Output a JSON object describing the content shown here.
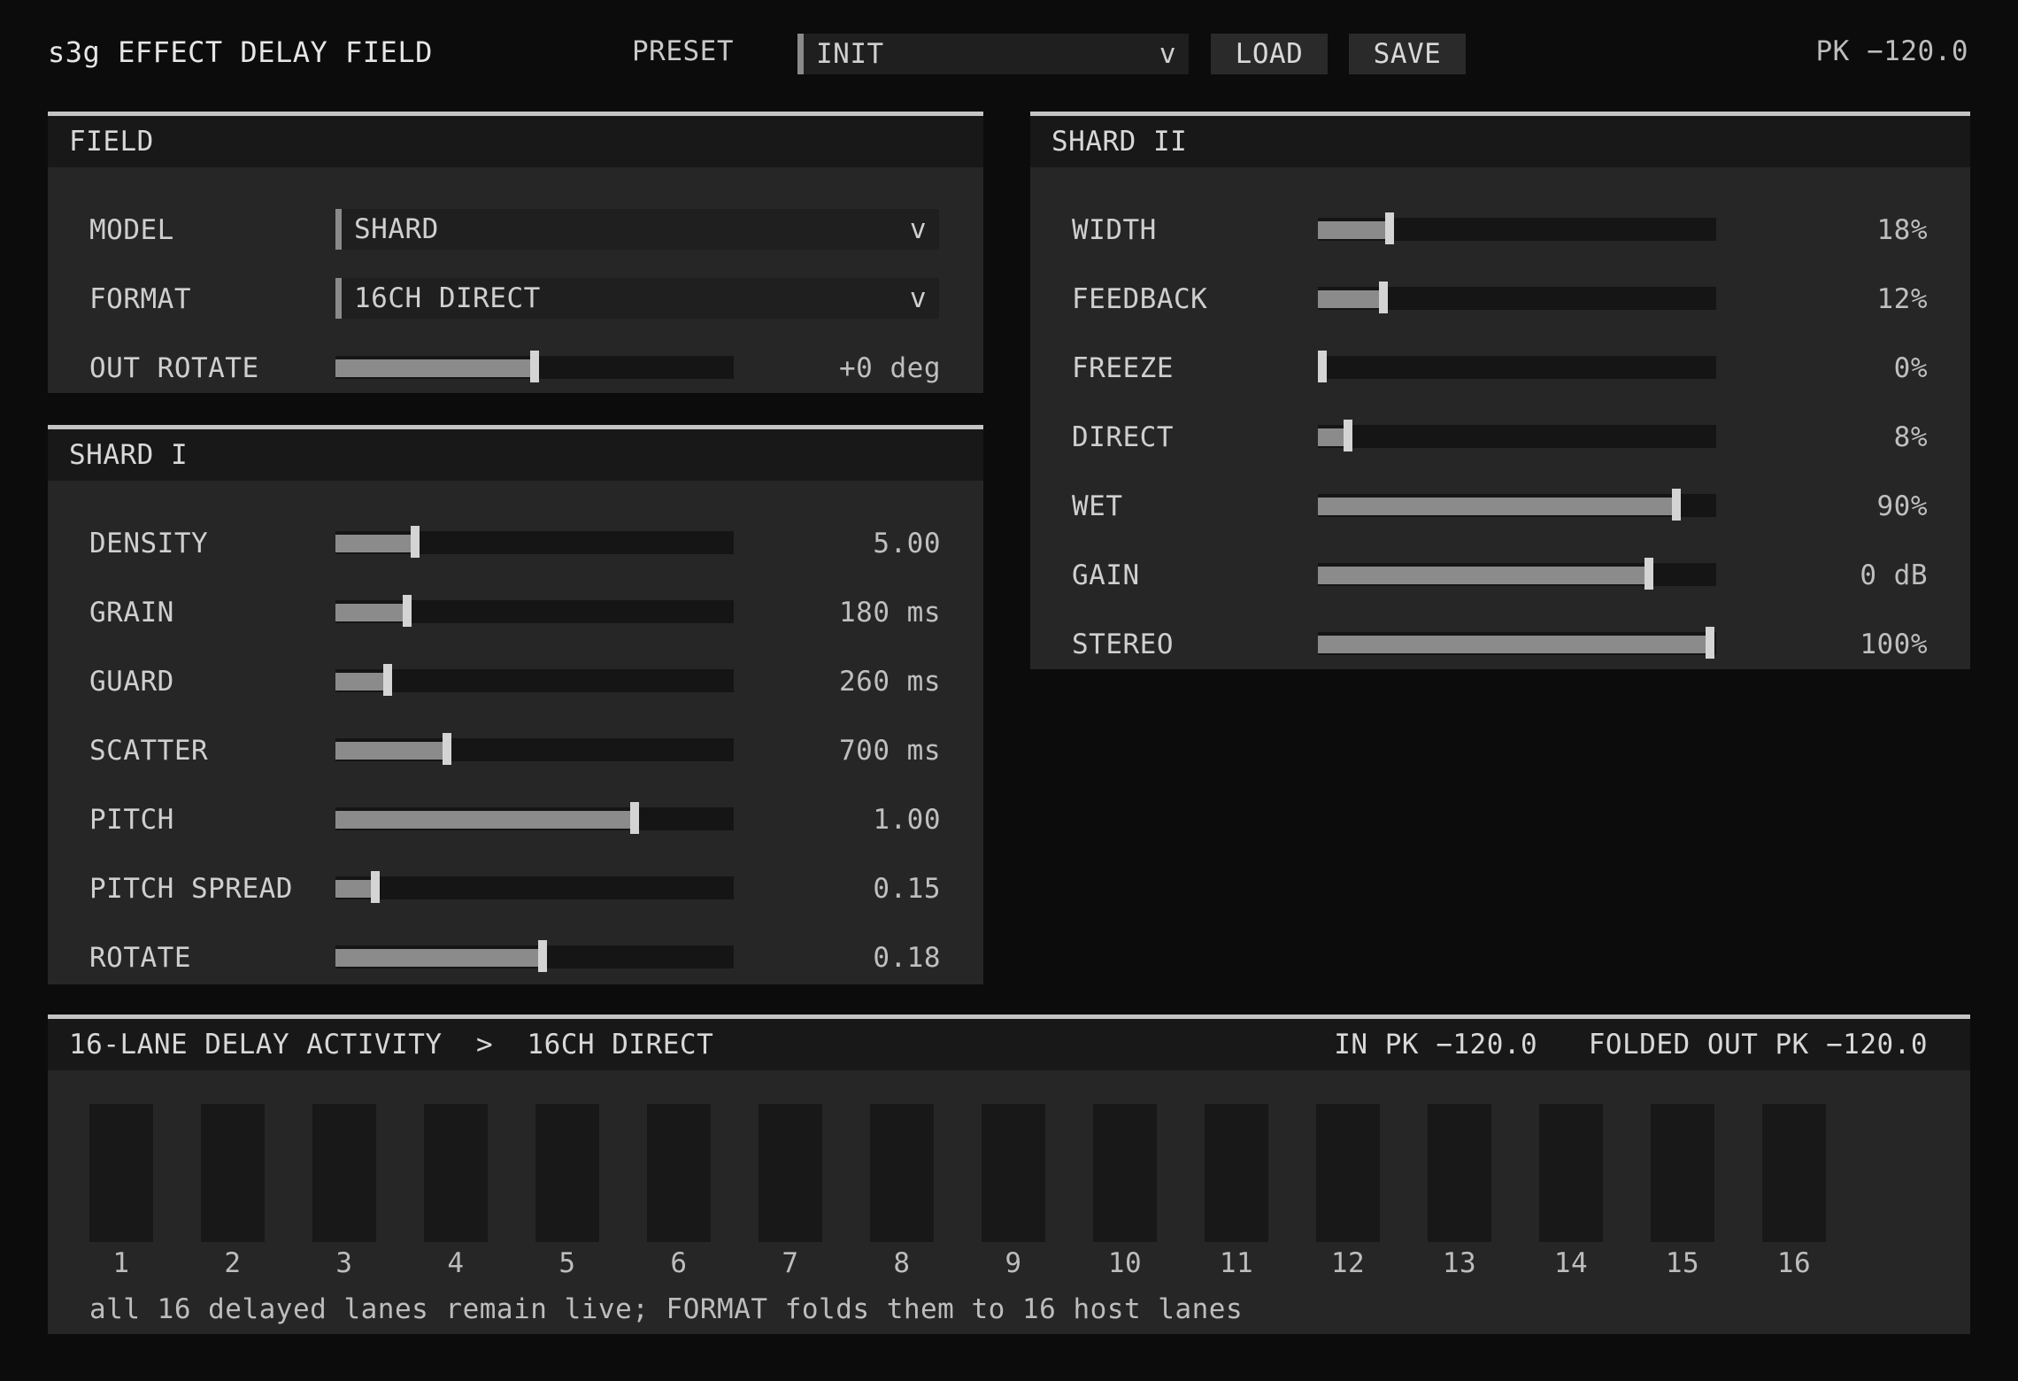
{
  "header": {
    "title": "s3g EFFECT DELAY FIELD",
    "preset_label": "PRESET",
    "preset_value": "INIT",
    "dropdown_caret": "v",
    "load_label": "LOAD",
    "save_label": "SAVE",
    "peak": "PK −120.0"
  },
  "field": {
    "title": "FIELD",
    "model_label": "MODEL",
    "model_value": "SHARD",
    "format_label": "FORMAT",
    "format_value": "16CH DIRECT",
    "out_rotate_label": "OUT ROTATE",
    "out_rotate_value": "+0 deg",
    "out_rotate_level": 0.5
  },
  "shard1": {
    "title": "SHARD I",
    "params": [
      {
        "label": "DENSITY",
        "value": "5.00",
        "level": 0.2
      },
      {
        "label": "GRAIN",
        "value": "180 ms",
        "level": 0.18
      },
      {
        "label": "GUARD",
        "value": "260 ms",
        "level": 0.13
      },
      {
        "label": "SCATTER",
        "value": "700 ms",
        "level": 0.28
      },
      {
        "label": "PITCH",
        "value": "1.00",
        "level": 0.75
      },
      {
        "label": "PITCH SPREAD",
        "value": "0.15",
        "level": 0.1
      },
      {
        "label": "ROTATE",
        "value": "0.18",
        "level": 0.52
      }
    ]
  },
  "shard2": {
    "title": "SHARD II",
    "params": [
      {
        "label": "WIDTH",
        "value": "18%",
        "level": 0.18
      },
      {
        "label": "FEEDBACK",
        "value": "12%",
        "level": 0.165
      },
      {
        "label": "FREEZE",
        "value": "0%",
        "level": 0.01
      },
      {
        "label": "DIRECT",
        "value": "8%",
        "level": 0.075
      },
      {
        "label": "WET",
        "value": "90%",
        "level": 0.9
      },
      {
        "label": "GAIN",
        "value": "0 dB",
        "level": 0.83
      },
      {
        "label": "STEREO",
        "value": "100%",
        "level": 0.985
      }
    ]
  },
  "activity": {
    "title": "16-LANE DELAY ACTIVITY",
    "separator": ">",
    "format": "16CH DIRECT",
    "in_peak": "IN PK −120.0",
    "out_peak": "FOLDED OUT PK −120.0",
    "lanes": [
      "1",
      "2",
      "3",
      "4",
      "5",
      "6",
      "7",
      "8",
      "9",
      "10",
      "11",
      "12",
      "13",
      "14",
      "15",
      "16"
    ],
    "note": "all 16 delayed lanes remain live; FORMAT folds them to 16 host lanes"
  },
  "colors": {
    "background": "#0c0c0c",
    "panel": "#262626",
    "panel_header": "#181818",
    "slider_fill": "#8b8b8b",
    "slider_thumb": "#d4d4d4"
  }
}
